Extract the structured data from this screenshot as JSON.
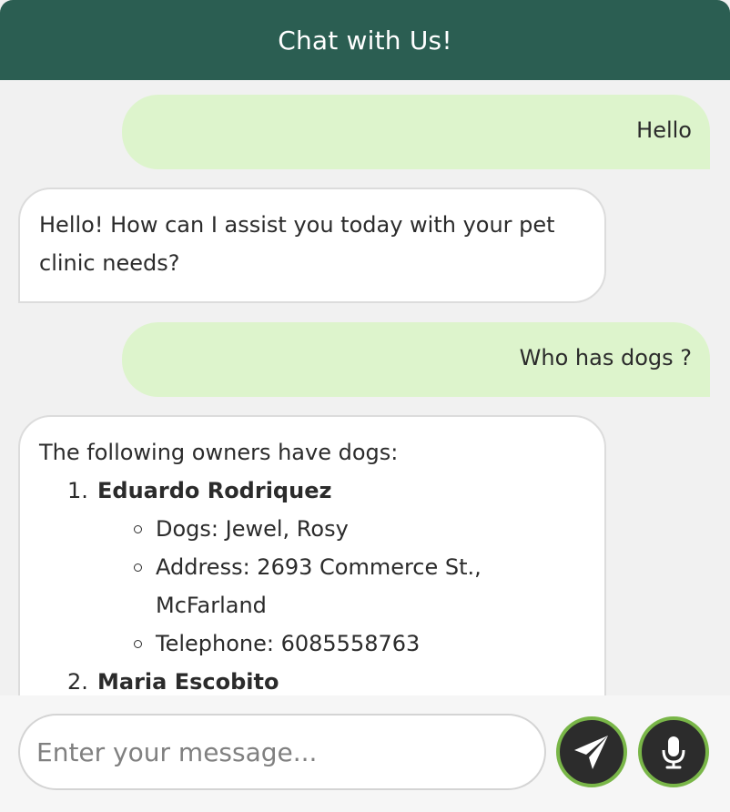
{
  "header": {
    "title": "Chat with Us!"
  },
  "messages": [
    {
      "sender": "user",
      "text": "Hello"
    },
    {
      "sender": "bot",
      "text": "Hello! How can I assist you today with your pet clinic needs?"
    },
    {
      "sender": "user",
      "text": "Who has dogs ?"
    },
    {
      "sender": "bot",
      "intro": "The following owners have dogs:",
      "owners": [
        {
          "number": "1.",
          "name": "Eduardo Rodriquez",
          "details": [
            "Dogs: Jewel, Rosy",
            "Address: 2693 Commerce St., McFarland",
            "Telephone: 6085558763"
          ]
        },
        {
          "number": "2.",
          "name": "Maria Escobito"
        }
      ]
    }
  ],
  "input": {
    "placeholder": "Enter your message...",
    "value": ""
  },
  "buttons": {
    "send_icon": "send-icon",
    "mic_icon": "microphone-icon"
  },
  "colors": {
    "header_bg": "#2b5e52",
    "user_bubble": "#ddf4cc",
    "bot_bubble": "#ffffff",
    "button_bg": "#2c2c2c",
    "button_ring": "#79b648"
  }
}
